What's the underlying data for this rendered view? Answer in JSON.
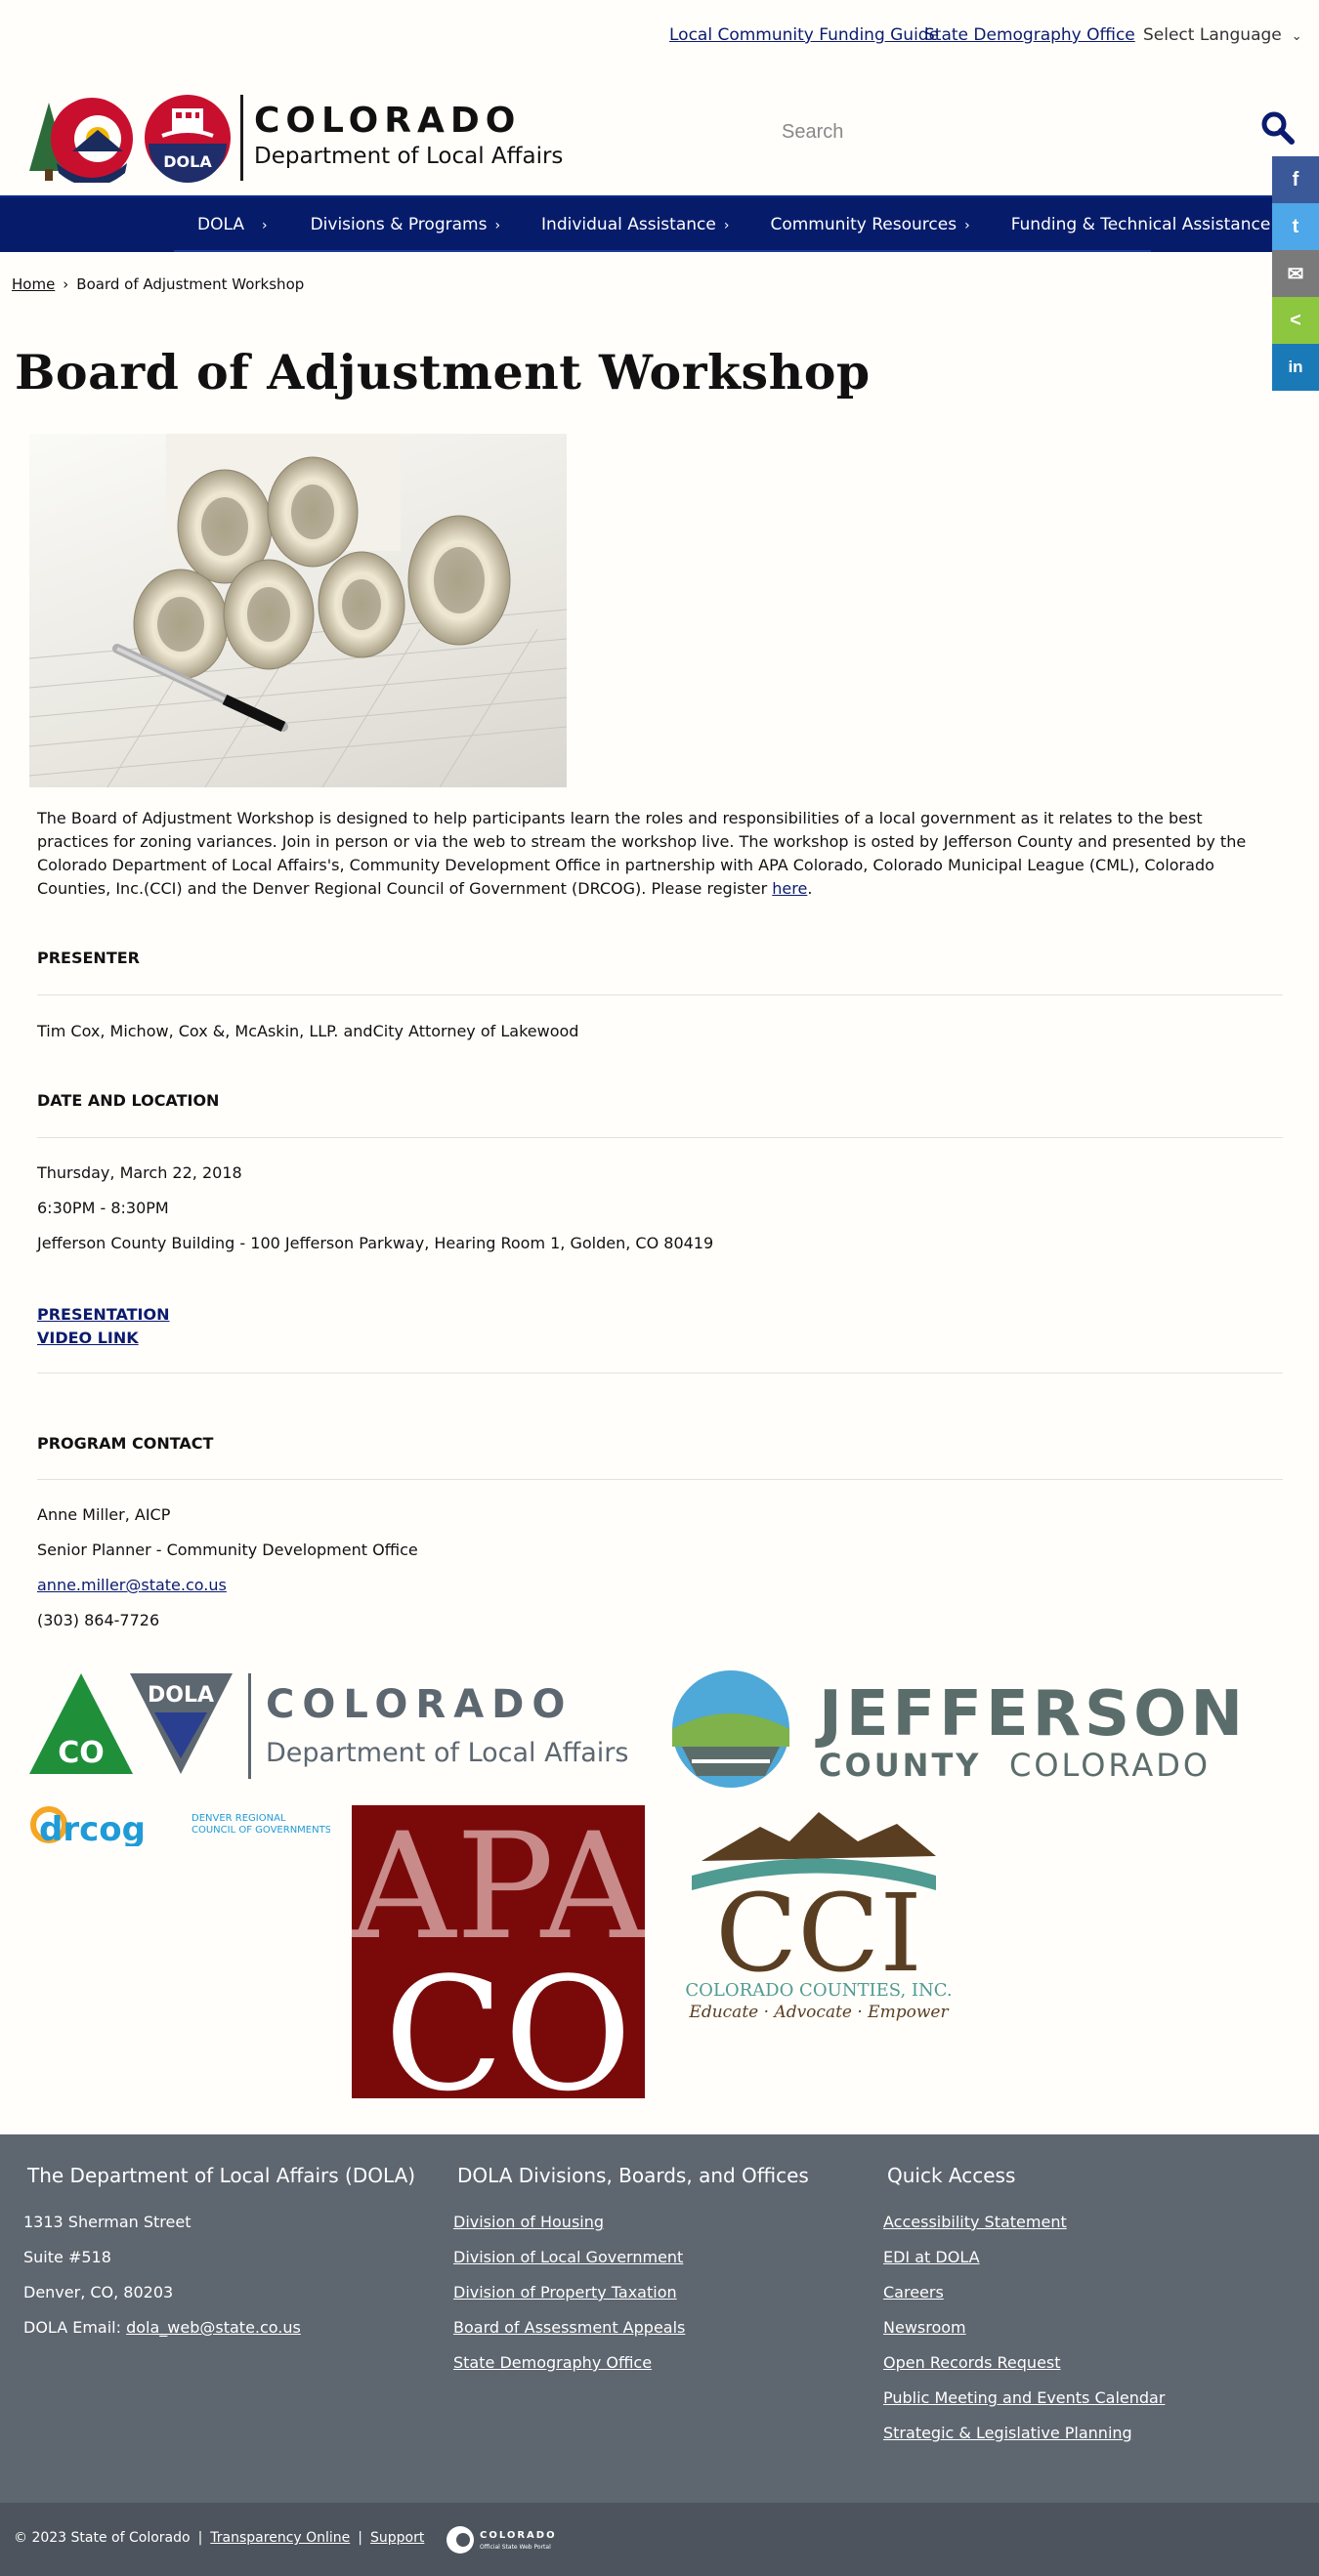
{
  "utility": {
    "link1": "Local Community Funding Guide",
    "link2": "State Demography Office",
    "language": "Select Language"
  },
  "header": {
    "logo_title": "COLORADO",
    "logo_subtitle": "Department of Local Affairs",
    "logo_co_text": "CO",
    "logo_dola_text": "DOLA",
    "search_placeholder": "Search"
  },
  "nav": {
    "items": [
      {
        "label": "DOLA"
      },
      {
        "label": "Divisions & Programs"
      },
      {
        "label": "Individual Assistance"
      },
      {
        "label": "Community Resources"
      },
      {
        "label": "Funding & Technical Assistance"
      }
    ]
  },
  "social": {
    "facebook": "f",
    "twitter": "t",
    "email": "✉",
    "share": "<",
    "linkedin": "in"
  },
  "breadcrumb": {
    "home": "Home",
    "current": "Board of Adjustment Workshop"
  },
  "page": {
    "title": "Board of Adjustment Workshop",
    "intro_text": " The Board of Adjustment Workshop is designed to help participants learn the roles and responsibilities of a local government as it relates to the best practices for zoning variances. Join in person or via the web to stream the workshop live. The workshop is osted by Jefferson County and presented by the Colorado Department of Local Affairs's, Community Development Office in partnership with APA Colorado, Colorado Municipal League (CML), Colorado Counties, Inc.(CCI) and the Denver Regional Council of Government (DRCOG). Please register ",
    "intro_link": "here",
    "intro_end": ".",
    "presenter_title": "PRESENTER",
    "presenter_text": "Tim Cox, Michow, Cox &, McAskin, LLP. andCity Attorney of Lakewood",
    "date_title": "DATE AND LOCATION",
    "date": "Thursday, March 22, 2018",
    "time": "6:30PM - 8:30PM",
    "location": "Jefferson County Building - 100 Jefferson Parkway, Hearing Room 1, Golden, CO 80419",
    "link_presentation": "PRESENTATION",
    "link_video": "VIDEO LINK",
    "contact_title": "PROGRAM CONTACT",
    "contact_name": "Anne Miller, AICP",
    "contact_role": "Senior Planner - Community Development Office",
    "contact_email": "anne.miller@state.co.us",
    "contact_phone": "(303) 864-7726"
  },
  "partners": {
    "dola_title": "COLORADO",
    "dola_sub": "Department of Local Affairs",
    "dola_badge": "DOLA",
    "co_badge": "CO",
    "jeff_title": "JEFFERSON",
    "jeff_county": "COUNTY",
    "jeff_colorado": "COLORADO",
    "drcog": "drcog",
    "drcog_sub1": "DENVER REGIONAL",
    "drcog_sub2": "COUNCIL OF GOVERNMENTS",
    "apa_top": "APA",
    "apa_bottom": "CO",
    "cci": "CCI",
    "cci_name": "COLORADO COUNTIES, INC.",
    "cci_tag": "Educate · Advocate · Empower"
  },
  "footer": {
    "col1_title": "The Department of Local Affairs (DOLA)",
    "address1": "1313 Sherman Street",
    "address2": "Suite  #518",
    "address3": "Denver, CO, 80203",
    "email_label": "DOLA Email: ",
    "email": "dola_web@state.co.us",
    "col2_title": "DOLA Divisions, Boards, and Offices",
    "col2_links": [
      "Division of Housing",
      "Division of Local Government",
      "Division of Property Taxation",
      "Board of Assessment Appeals",
      "State Demography Office"
    ],
    "col3_title": "Quick Access",
    "col3_links": [
      "Accessibility Statement",
      "EDI at DOLA",
      "Careers",
      "Newsroom",
      "Open Records Request",
      "Public Meeting and Events Calendar",
      "Strategic & Legislative Planning"
    ],
    "copyright": "© 2023 State of Colorado",
    "transparency": "Transparency Online",
    "support": "Support",
    "portal_title": "COLORADO",
    "portal_sub": "Official State Web Portal"
  },
  "colors": {
    "nav_bg": "#061c6b",
    "footer_bg": "#5e6670",
    "link": "#0b1b6e",
    "apa_red": "#7a0a0a",
    "jeff_gray": "#5b6d6b"
  }
}
